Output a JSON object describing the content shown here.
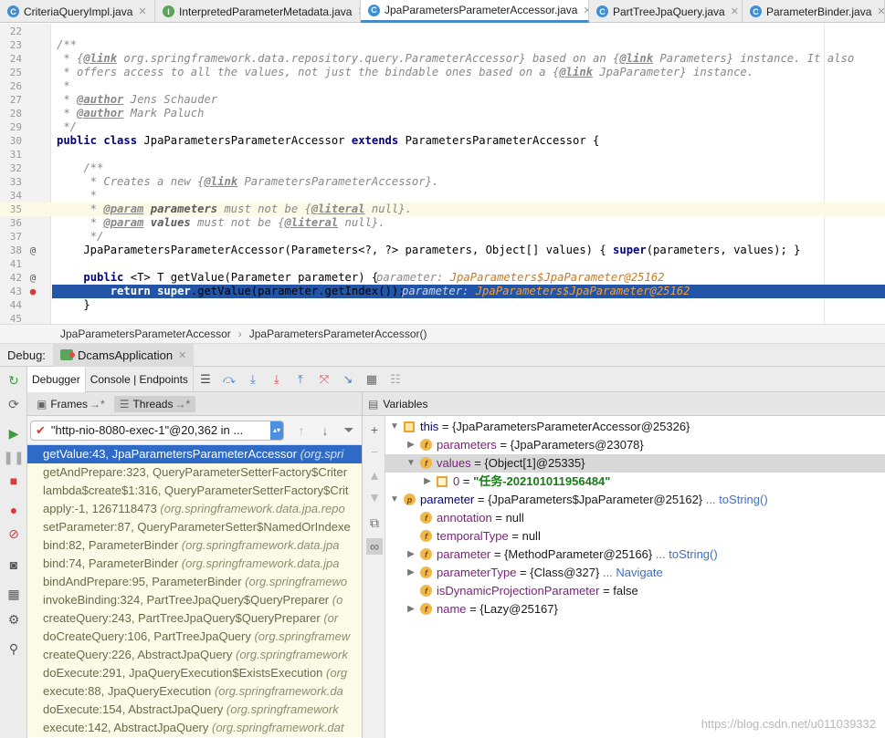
{
  "tabs": [
    {
      "label": "CriteriaQueryImpl.java",
      "icon": "C",
      "color": "#3f8fd3"
    },
    {
      "label": "InterpretedParameterMetadata.java",
      "icon": "I",
      "color": "#5aa55a"
    },
    {
      "label": "JpaParametersParameterAccessor.java",
      "icon": "C",
      "color": "#3f8fd3"
    },
    {
      "label": "PartTreeJpaQuery.java",
      "icon": "C",
      "color": "#3f8fd3"
    },
    {
      "label": "ParameterBinder.java",
      "icon": "C",
      "color": "#3f8fd3"
    }
  ],
  "editor": {
    "lines": [
      {
        "n": "22",
        "code": ""
      },
      {
        "n": "23",
        "code": "/**"
      },
      {
        "n": "24",
        "code": " * {@link org.springframework.data.repository.query.ParameterAccessor} based on an {@link Parameters} instance. It also"
      },
      {
        "n": "25",
        "code": " * offers access to all the values, not just the bindable ones based on a {@link JpaParameter} instance."
      },
      {
        "n": "26",
        "code": " *"
      },
      {
        "n": "27",
        "code": " * @author Jens Schauder"
      },
      {
        "n": "28",
        "code": " * @author Mark Paluch"
      },
      {
        "n": "29",
        "code": " */"
      },
      {
        "n": "30",
        "code": "public class JpaParametersParameterAccessor extends ParametersParameterAccessor {"
      },
      {
        "n": "31",
        "code": ""
      },
      {
        "n": "32",
        "code": "    /**"
      },
      {
        "n": "33",
        "code": "     * Creates a new {@link ParametersParameterAccessor}."
      },
      {
        "n": "34",
        "code": "     *"
      },
      {
        "n": "35",
        "code": "     * @param parameters must not be {@literal null}."
      },
      {
        "n": "36",
        "code": "     * @param values must not be {@literal null}."
      },
      {
        "n": "37",
        "code": "     */"
      },
      {
        "n": "38",
        "code": "    JpaParametersParameterAccessor(Parameters<?, ?> parameters, Object[] values) { super(parameters, values); }"
      },
      {
        "n": "41",
        "code": ""
      },
      {
        "n": "42",
        "code": "    public <T> T getValue(Parameter parameter) {"
      },
      {
        "n": "43",
        "code": "        return super.getValue(parameter.getIndex());"
      },
      {
        "n": "44",
        "code": "    }"
      },
      {
        "n": "45",
        "code": ""
      }
    ],
    "hint_42_label": "parameter:",
    "hint_42_value": "JpaParameters$JpaParameter@25162",
    "hint_43_label": "parameter:",
    "hint_43_value": "JpaParameters$JpaParameter@25162"
  },
  "breadcrumb": [
    "JpaParametersParameterAccessor",
    "JpaParametersParameterAccessor()"
  ],
  "debug": {
    "label": "Debug:",
    "app_name": "DcamsApplication",
    "tab_debugger": "Debugger",
    "tab_console": "Console | Endpoints",
    "frames_tab": "Frames",
    "threads_tab": "Threads",
    "frames_arrow": "→*",
    "threads_arrow": "→*",
    "thread_selected": "\"http-nio-8080-exec-1\"@20,362 in ...",
    "variables_label": "Variables"
  },
  "frames": [
    {
      "method": "getValue:43, JpaParametersParameterAccessor",
      "pkg": "(org.spri"
    },
    {
      "method": "getAndPrepare:323, QueryParameterSetterFactory$Criter",
      "pkg": ""
    },
    {
      "method": "lambda$create$1:316, QueryParameterSetterFactory$Crit",
      "pkg": ""
    },
    {
      "method": "apply:-1, 1267118473",
      "pkg": "(org.springframework.data.jpa.repo"
    },
    {
      "method": "setParameter:87, QueryParameterSetter$NamedOrIndexe",
      "pkg": ""
    },
    {
      "method": "bind:82, ParameterBinder",
      "pkg": "(org.springframework.data.jpa"
    },
    {
      "method": "bind:74, ParameterBinder",
      "pkg": "(org.springframework.data.jpa"
    },
    {
      "method": "bindAndPrepare:95, ParameterBinder",
      "pkg": "(org.springframewo"
    },
    {
      "method": "invokeBinding:324, PartTreeJpaQuery$QueryPreparer",
      "pkg": "(o"
    },
    {
      "method": "createQuery:243, PartTreeJpaQuery$QueryPreparer",
      "pkg": "(or"
    },
    {
      "method": "doCreateQuery:106, PartTreeJpaQuery",
      "pkg": "(org.springframew"
    },
    {
      "method": "createQuery:226, AbstractJpaQuery",
      "pkg": "(org.springframework"
    },
    {
      "method": "doExecute:291, JpaQueryExecution$ExistsExecution",
      "pkg": "(org"
    },
    {
      "method": "execute:88, JpaQueryExecution",
      "pkg": "(org.springframework.da"
    },
    {
      "method": "doExecute:154, AbstractJpaQuery",
      "pkg": "(org.springframework"
    },
    {
      "method": "execute:142, AbstractJpaQuery",
      "pkg": "(org.springframework.dat"
    }
  ],
  "variables": [
    {
      "indent": 0,
      "tw": "▼",
      "icon": "this",
      "name": "this",
      "eq": " = ",
      "val": "{JpaParametersParameterAccessor@25326}",
      "link": "",
      "str": ""
    },
    {
      "indent": 1,
      "tw": "▶",
      "icon": "f",
      "name": "parameters",
      "eq": " = ",
      "val": "{JpaParameters@23078}",
      "link": "",
      "str": ""
    },
    {
      "indent": 1,
      "tw": "▼",
      "icon": "f",
      "name": "values",
      "eq": " = ",
      "val": "{Object[1]@25335}",
      "link": "",
      "str": ""
    },
    {
      "indent": 2,
      "tw": "▶",
      "icon": "arr",
      "name": "0",
      "eq": " = ",
      "val": "",
      "link": "",
      "str": "\"任务-20210101195648​4\""
    },
    {
      "indent": 0,
      "tw": "▼",
      "icon": "p",
      "name": "parameter",
      "eq": " = ",
      "val": "{JpaParameters$JpaParameter@25162}",
      "link": " ... toString()",
      "str": ""
    },
    {
      "indent": 1,
      "tw": "",
      "icon": "f",
      "name": "annotation",
      "eq": " = ",
      "val": "null",
      "link": "",
      "str": ""
    },
    {
      "indent": 1,
      "tw": "",
      "icon": "f",
      "name": "temporalType",
      "eq": " = ",
      "val": "null",
      "link": "",
      "str": ""
    },
    {
      "indent": 1,
      "tw": "▶",
      "icon": "f",
      "name": "parameter",
      "eq": " = ",
      "val": "{MethodParameter@25166}",
      "link": " ... toString()",
      "str": ""
    },
    {
      "indent": 1,
      "tw": "▶",
      "icon": "f",
      "name": "parameterType",
      "eq": " = ",
      "val": "{Class@327}",
      "link": " ... Navigate",
      "str": ""
    },
    {
      "indent": 1,
      "tw": "",
      "icon": "f",
      "name": "isDynamicProjectionParameter",
      "eq": " = ",
      "val": "false",
      "link": "",
      "str": ""
    },
    {
      "indent": 1,
      "tw": "▶",
      "icon": "f",
      "name": "name",
      "eq": " = ",
      "val": "{Lazy@25167}",
      "link": "",
      "str": ""
    }
  ],
  "watermark": "https://blog.csdn.net/u011039332"
}
